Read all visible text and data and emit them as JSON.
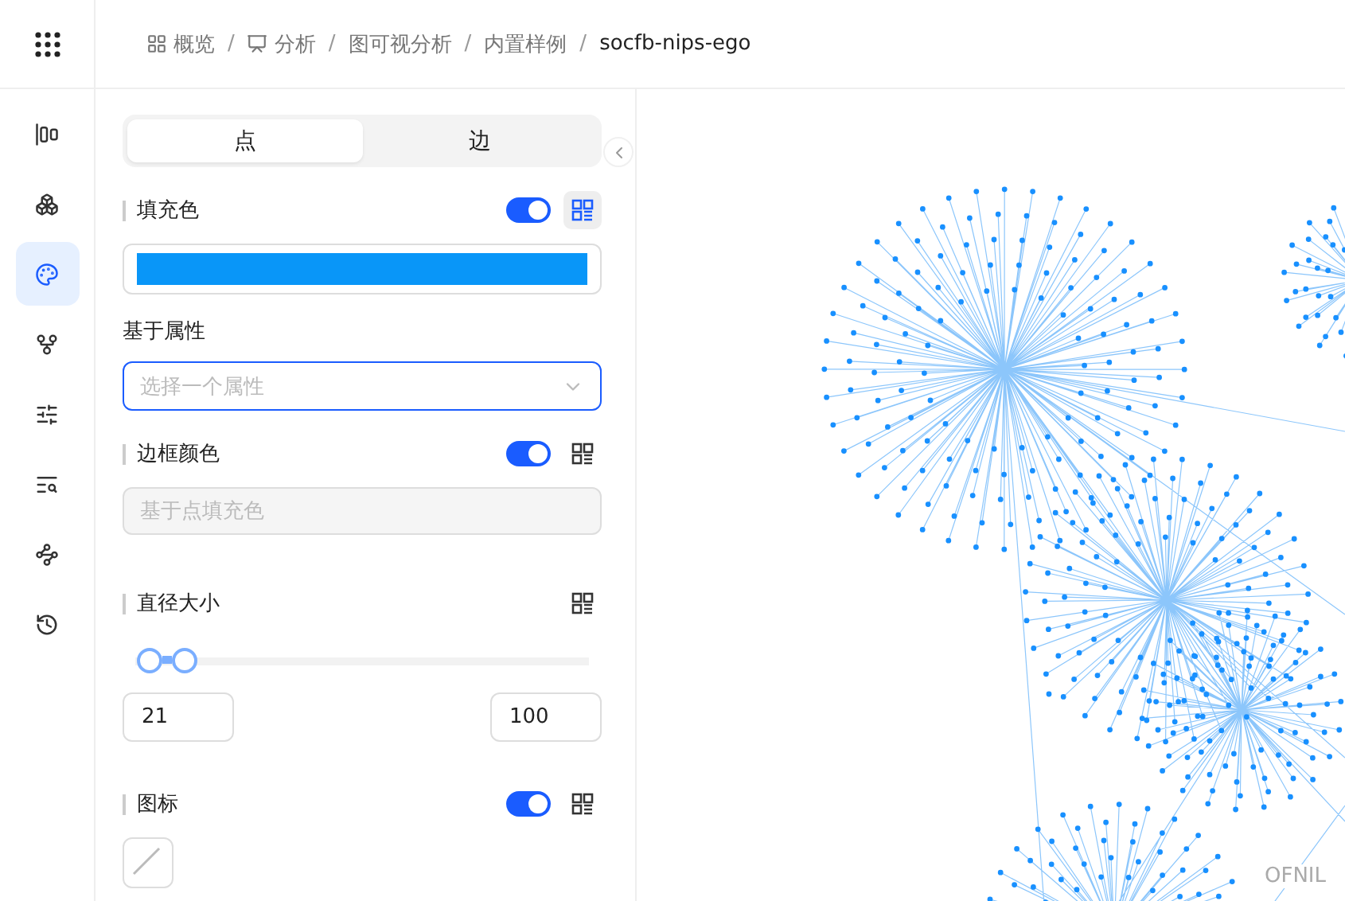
{
  "breadcrumb_separator": "/",
  "breadcrumb": [
    {
      "label": "概览",
      "kind": "overview"
    },
    {
      "label": "分析",
      "kind": "analysis"
    },
    {
      "label": "图可视分析",
      "kind": "plain"
    },
    {
      "label": "内置样例",
      "kind": "plain"
    },
    {
      "label": "socfb-nips-ego",
      "kind": "current"
    }
  ],
  "nav": [
    {
      "kind": "layout",
      "selected": false
    },
    {
      "kind": "cube",
      "selected": false
    },
    {
      "kind": "palette",
      "selected": true
    },
    {
      "kind": "fork",
      "selected": false
    },
    {
      "kind": "sliders",
      "selected": false
    },
    {
      "kind": "search",
      "selected": false
    },
    {
      "kind": "nodes",
      "selected": false
    },
    {
      "kind": "history",
      "selected": false
    }
  ],
  "tabs": [
    {
      "label": "点",
      "selected": true
    },
    {
      "label": "边",
      "selected": false
    }
  ],
  "fill": {
    "title": "填充色",
    "on": true,
    "mapping_active": true,
    "attribute_label": "基于属性",
    "attribute_placeholder": "选择一个属性"
  },
  "border": {
    "title": "边框颜色",
    "on": true,
    "mapping_active": false,
    "placeholder": "基于点填充色"
  },
  "size": {
    "title": "直径大小",
    "mapping_active": false,
    "thumbs": [
      {
        "level": 0.03
      },
      {
        "level": 0.11
      }
    ],
    "min": "21",
    "max": "100"
  },
  "icon": {
    "title": "图标",
    "on": true,
    "mapping_active": false
  },
  "canvas": {
    "label": "OFNIL"
  }
}
